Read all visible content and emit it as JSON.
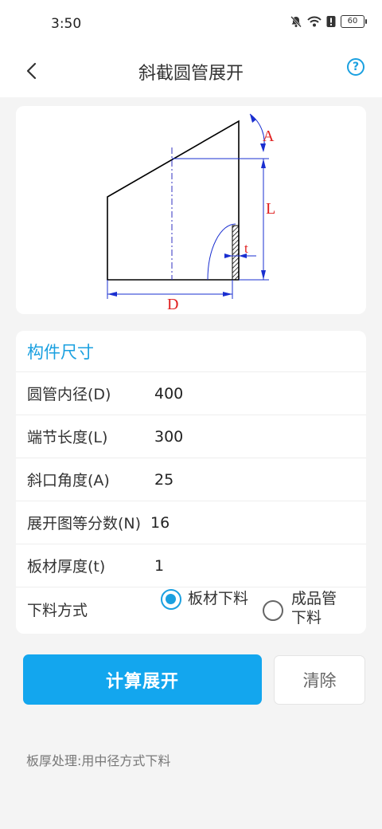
{
  "status_bar": {
    "time": "3:50",
    "battery": "60",
    "icons": [
      "mute-icon",
      "wifi-icon",
      "alert-icon",
      "battery-icon"
    ]
  },
  "app_bar": {
    "title": "斜截圆管展开",
    "back_icon": "chevron-left-icon",
    "help_label": "?"
  },
  "diagram": {
    "labels": {
      "angle": "A",
      "length": "L",
      "thickness": "t",
      "diameter": "D"
    },
    "colors": {
      "outline": "#000000",
      "dimension": "#1a2fd0",
      "label": "#e02020",
      "axis": "#3030c0"
    }
  },
  "dimensions": {
    "header": "构件尺寸",
    "fields": [
      {
        "label": "圆管内径(D)",
        "value": "400"
      },
      {
        "label": "端节长度(L)",
        "value": "300"
      },
      {
        "label": "斜口角度(A)",
        "value": "25"
      },
      {
        "label": "展开图等分数(N)",
        "value": "16"
      },
      {
        "label": "板材厚度(t)",
        "value": "1"
      }
    ],
    "cut_method": {
      "label": "下料方式",
      "options": [
        {
          "label": "板材下料",
          "checked": true
        },
        {
          "label": "成品管下料",
          "checked": false
        }
      ]
    }
  },
  "actions": {
    "compute": "计算展开",
    "clear": "清除"
  },
  "note": "板厚处理:用中径方式下料",
  "colors": {
    "accent": "#1aa0e0",
    "primary_button": "#13a6ee",
    "background": "#f4f4f4"
  }
}
